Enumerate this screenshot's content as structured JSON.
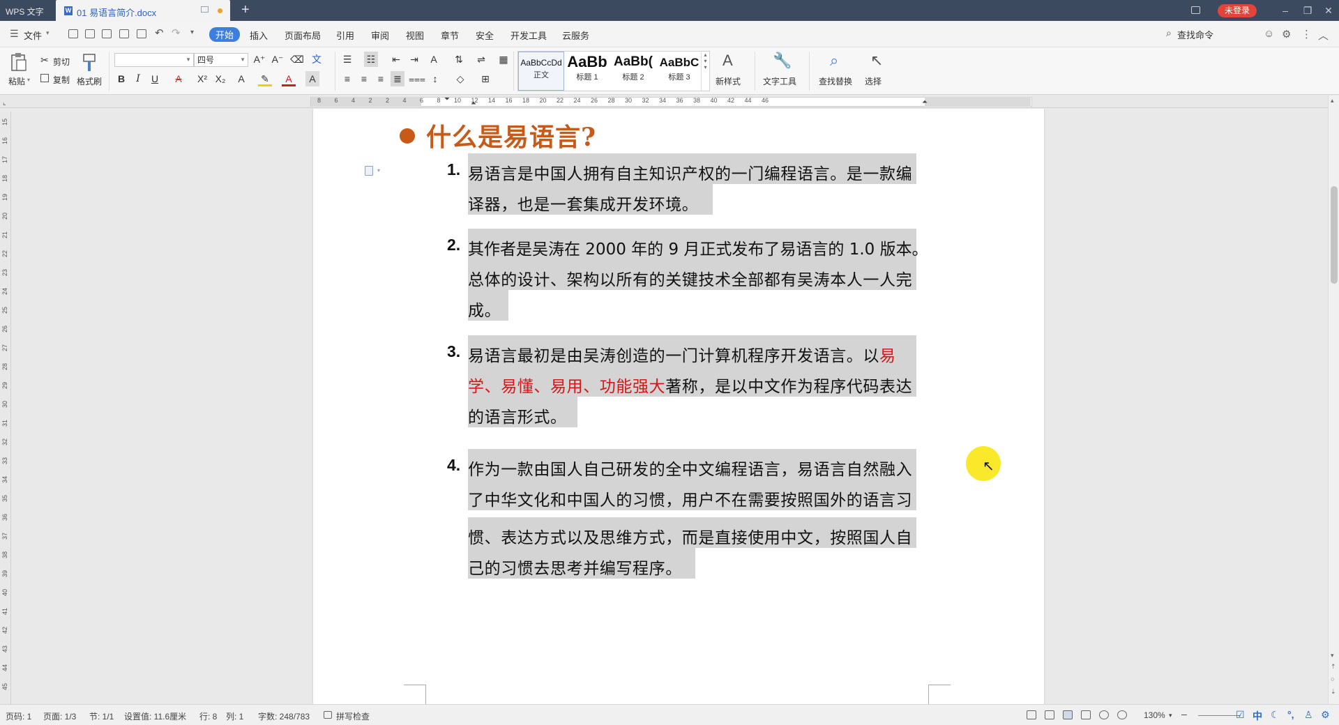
{
  "titlebar": {
    "app_name": "WPS 文字",
    "doc_tab": "01 易语言简介.docx",
    "login": "未登录"
  },
  "menu": {
    "file": "文件",
    "tabs": [
      "开始",
      "插入",
      "页面布局",
      "引用",
      "审阅",
      "视图",
      "章节",
      "安全",
      "开发工具",
      "云服务"
    ],
    "search_cmd": "查找命令"
  },
  "ribbon": {
    "paste": "粘贴",
    "cut": "剪切",
    "copy": "复制",
    "format_painter": "格式刷",
    "font_name": "",
    "font_size": "四号",
    "styles": [
      {
        "sample": "AaBbCcDd",
        "name": "正文"
      },
      {
        "sample": "AaBb",
        "name": "标题 1"
      },
      {
        "sample": "AaBb(",
        "name": "标题 2"
      },
      {
        "sample": "AaBbC",
        "name": "标题 3"
      }
    ],
    "new_style": "新样式",
    "text_tools": "文字工具",
    "find_replace": "查找替换",
    "select": "选择"
  },
  "ruler": {
    "h_numbers": [
      "8",
      "6",
      "4",
      "2",
      "2",
      "4",
      "6",
      "8",
      "10",
      "12",
      "14",
      "16",
      "18",
      "20",
      "22",
      "24",
      "26",
      "28",
      "30",
      "32",
      "34",
      "36",
      "38",
      "40",
      "42",
      "44",
      "46"
    ],
    "v_numbers": [
      "15",
      "16",
      "17",
      "18",
      "19",
      "20",
      "21",
      "22",
      "23",
      "24",
      "25",
      "26",
      "27",
      "28",
      "29",
      "30",
      "31",
      "32",
      "33",
      "34",
      "35",
      "36",
      "37",
      "38",
      "39",
      "40",
      "41",
      "42",
      "43",
      "44",
      "45"
    ]
  },
  "document": {
    "heading": "什么是易语言?",
    "items": [
      {
        "num": "1.",
        "lines": [
          "易语言是中国人拥有自主知识产权的一门编程语言。是一款编",
          "译器，也是一套集成开发环境。"
        ]
      },
      {
        "num": "2.",
        "lines": [
          "其作者是吴涛在 2000 年的 9 月正式发布了易语言的 1.0 版本。",
          "总体的设计、架构以所有的关键技术全部都有吴涛本人一人完",
          "成。"
        ]
      },
      {
        "num": "3.",
        "line1_pre": "易语言最初是由吴涛创造的一门计算机程序开发语言。以",
        "line1_red": "易",
        "line2_red": "学、易懂、易用、功能强大",
        "line2_post": "著称，是以中文作为程序代码表达",
        "line3": "的语言形式。"
      },
      {
        "num": "4.",
        "lines": [
          "作为一款由国人自己研发的全中文编程语言，易语言自然融入",
          "了中华文化和中国人的习惯，用户不在需要按照国外的语言习",
          "惯、表达方式以及思维方式，而是直接使用中文，按照国人自",
          "己的习惯去思考并编写程序。"
        ]
      }
    ]
  },
  "status": {
    "page_num": "页码: 1",
    "pages": "页面: 1/3",
    "section": "节: 1/1",
    "setting": "设置值: 11.6厘米",
    "row": "行: 8",
    "col": "列: 1",
    "word_count": "字数: 248/783",
    "spell_check": "拼写检查",
    "zoom": "130%",
    "ime": "中"
  },
  "colors": {
    "heading": "#c85a18",
    "emphasis_red": "#d21818",
    "selection": "#d4d4d4",
    "active_tab": "#3d7fe0",
    "login_badge": "#e0443a"
  }
}
